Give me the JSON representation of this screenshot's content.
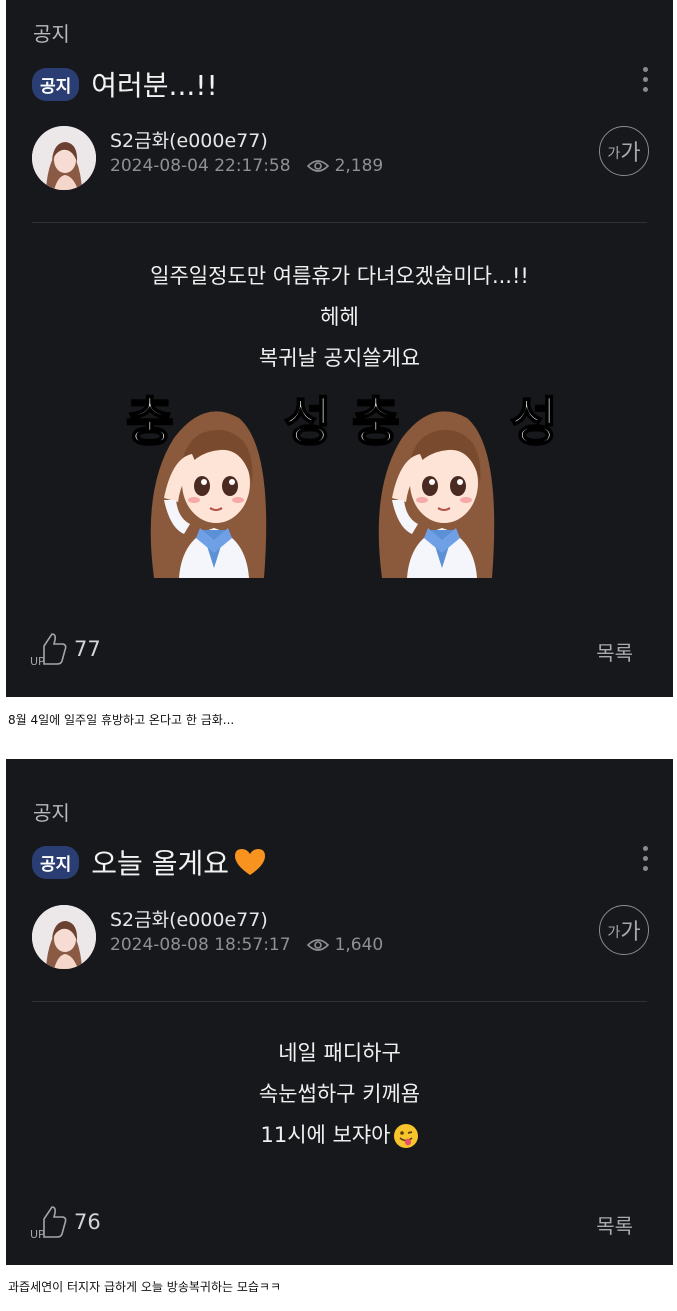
{
  "posts": [
    {
      "breadcrumb": "공지",
      "badge": "공지",
      "title": "여러분...!!",
      "author": "S2금화(e000e77)",
      "datetime": "2024-08-04 22:17:58",
      "views": "2,189",
      "font_button_small": "가",
      "font_button_large": "가",
      "body_lines": [
        "일주일정도만 여름휴가 다녀오겠숩미다...!!",
        "헤헤",
        "복귀날 공지쓸게요"
      ],
      "sticker_text": [
        "충",
        "성",
        "충",
        "성"
      ],
      "up_count": "77",
      "list_label": "목록",
      "caption": "8월 4일에 일주일 휴방하고 온다고 한 금화..."
    },
    {
      "breadcrumb": "공지",
      "badge": "공지",
      "title": "오늘 올게요",
      "author": "S2금화(e000e77)",
      "datetime": "2024-08-08 18:57:17",
      "views": "1,640",
      "font_button_small": "가",
      "font_button_large": "가",
      "body_lines": [
        "네일 패디하구",
        "속눈썹하구 키께욤",
        "11시에 보쟈아"
      ],
      "up_count": "76",
      "list_label": "목록",
      "caption": "과즙세연이 터지자 급하게 오늘 방송복귀하는 모습ㅋㅋ"
    }
  ],
  "up_label": "UP",
  "colors": {
    "panel_bg": "#17181b",
    "badge_bg": "#2b3e73",
    "heart": "#f7931e",
    "emoji": "#f7c52b"
  }
}
